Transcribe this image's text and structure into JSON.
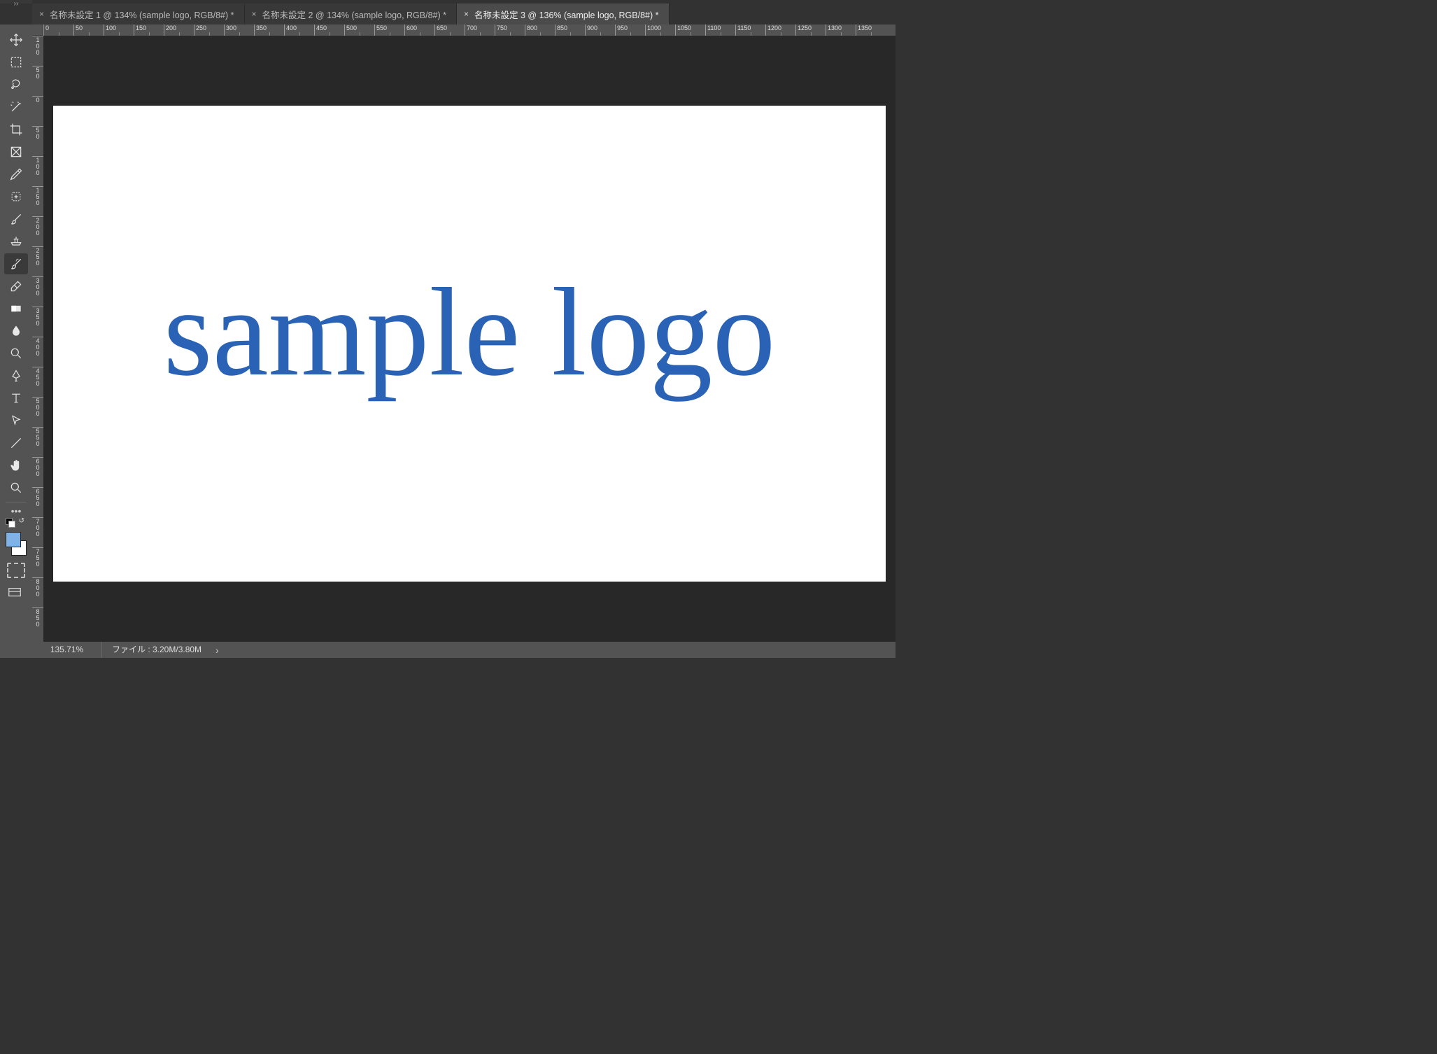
{
  "tabs": [
    {
      "label": "名称未設定 1 @ 134% (sample logo, RGB/8#) *",
      "active": false
    },
    {
      "label": "名称未設定 2 @ 134% (sample logo, RGB/8#) *",
      "active": false
    },
    {
      "label": "名称未設定 3 @ 136% (sample logo, RGB/8#) *",
      "active": true
    }
  ],
  "canvas": {
    "text": "sample logo",
    "text_color": "#2a62b6",
    "bg_color": "#ffffff"
  },
  "status": {
    "zoom": "135.71%",
    "file_label": "ファイル : 3.20M/3.80M"
  },
  "colors": {
    "foreground": "#7fb3e8",
    "background": "#ffffff"
  },
  "ruler": {
    "h_ticks": [
      "0",
      "50",
      "100",
      "150",
      "200",
      "250",
      "300",
      "350",
      "400",
      "450",
      "500",
      "550",
      "600",
      "650",
      "700",
      "750",
      "800",
      "850",
      "900",
      "950",
      "1000",
      "1050",
      "1100",
      "1150",
      "1200",
      "1250",
      "1300",
      "1350"
    ],
    "v_ticks": [
      "100",
      "50",
      "0",
      "50",
      "100",
      "150",
      "200",
      "250",
      "300",
      "350",
      "400",
      "450",
      "500",
      "550",
      "600",
      "650",
      "700",
      "750",
      "800",
      "850"
    ]
  },
  "tools": [
    {
      "name": "move-tool"
    },
    {
      "name": "marquee-tool"
    },
    {
      "name": "lasso-tool"
    },
    {
      "name": "magic-wand-tool"
    },
    {
      "name": "crop-tool"
    },
    {
      "name": "frame-tool"
    },
    {
      "name": "eyedropper-tool"
    },
    {
      "name": "healing-brush-tool"
    },
    {
      "name": "brush-tool"
    },
    {
      "name": "clone-stamp-tool"
    },
    {
      "name": "history-brush-tool",
      "selected": true
    },
    {
      "name": "eraser-tool"
    },
    {
      "name": "gradient-tool"
    },
    {
      "name": "blur-tool"
    },
    {
      "name": "dodge-tool"
    },
    {
      "name": "pen-tool"
    },
    {
      "name": "type-tool"
    },
    {
      "name": "path-selection-tool"
    },
    {
      "name": "line-tool"
    },
    {
      "name": "hand-tool"
    },
    {
      "name": "zoom-tool"
    }
  ]
}
